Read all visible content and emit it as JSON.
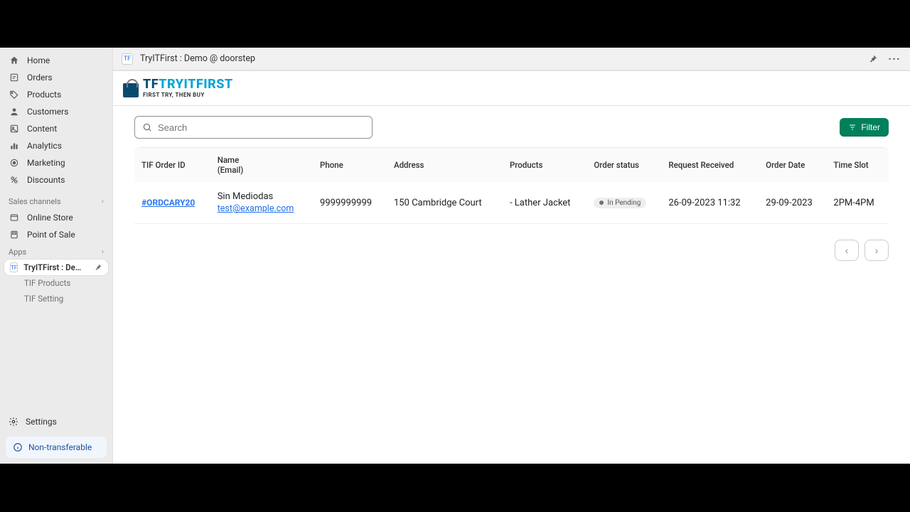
{
  "sidebar": {
    "items": [
      {
        "label": "Home"
      },
      {
        "label": "Orders"
      },
      {
        "label": "Products"
      },
      {
        "label": "Customers"
      },
      {
        "label": "Content"
      },
      {
        "label": "Analytics"
      },
      {
        "label": "Marketing"
      },
      {
        "label": "Discounts"
      }
    ],
    "sales_channels_header": "Sales channels",
    "channels": [
      {
        "label": "Online Store"
      },
      {
        "label": "Point of Sale"
      }
    ],
    "apps_header": "Apps",
    "active_app": "TryITFirst : Demo @ d…",
    "app_sub": [
      {
        "label": "TIF Products"
      },
      {
        "label": "TIF Setting"
      }
    ],
    "settings": "Settings",
    "nontransferable": "Non-transferable"
  },
  "header": {
    "title": "TryITFirst : Demo @ doorstep"
  },
  "brand": {
    "tf": "TF",
    "rest": "TRYITFIRST",
    "tagline": "FIRST TRY, THEN BUY"
  },
  "toolbar": {
    "search_placeholder": "Search",
    "filter_label": "Filter"
  },
  "table": {
    "headers": {
      "order_id": "TIF Order ID",
      "name": "Name",
      "email": "(Email)",
      "phone": "Phone",
      "address": "Address",
      "products": "Products",
      "status": "Order status",
      "received": "Request Received",
      "order_date": "Order Date",
      "slot": "Time Slot"
    },
    "row": {
      "order_id": "#ORDCARY20",
      "name": "Sin Mediodas",
      "email": "test@example.com",
      "phone": "9999999999",
      "address": "150 Cambridge Court",
      "products": "- Lather Jacket",
      "status": "In Pending",
      "received": "26-09-2023 11:32",
      "order_date": "29-09-2023",
      "slot": "2PM-4PM"
    }
  }
}
